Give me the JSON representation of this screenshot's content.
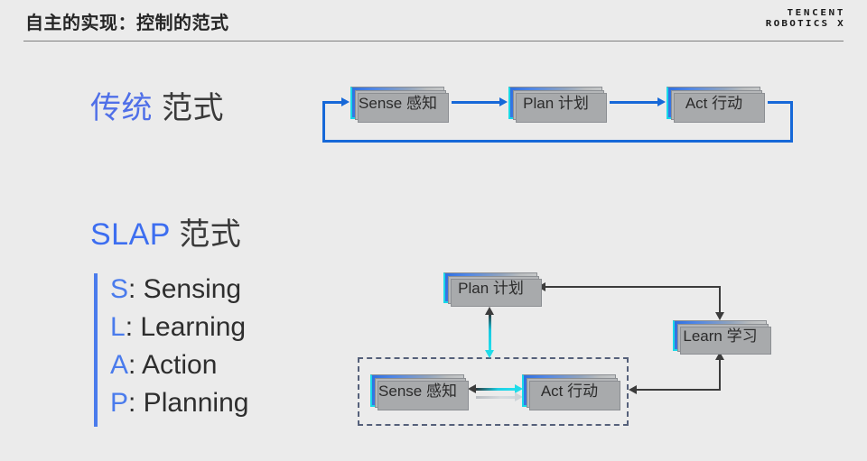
{
  "header": {
    "title": "自主的实现：控制的范式",
    "brand_line1": "TENCENT",
    "brand_line2": "ROBOTICS X"
  },
  "sections": {
    "traditional": {
      "accent": "传统",
      "rest": " 范式"
    },
    "slap": {
      "accent": "SLAP",
      "rest": " 范式"
    }
  },
  "slap_list": [
    {
      "key": "S",
      "text": ": Sensing"
    },
    {
      "key": "L",
      "text": ": Learning"
    },
    {
      "key": "A",
      "text": ": Action"
    },
    {
      "key": "P",
      "text": ": Planning"
    }
  ],
  "diagram_traditional": {
    "boxes": [
      {
        "label": "Sense 感知"
      },
      {
        "label": "Plan 计划"
      },
      {
        "label": "Act 行动"
      }
    ]
  },
  "diagram_slap": {
    "boxes": [
      {
        "label": "Plan 计划"
      },
      {
        "label": "Learn 学习"
      },
      {
        "label": "Sense 感知"
      },
      {
        "label": "Act 行动"
      }
    ]
  },
  "colors": {
    "background": "#ebebeb",
    "accent_blue": "#4a7bec",
    "arrow_blue": "#1668d8",
    "arrow_dark": "#3c3c3c",
    "cyan": "#20dce9",
    "box_blue": "#2f6fe0",
    "box_gray": "#c9cbcc",
    "dashed_border": "#55607a"
  }
}
